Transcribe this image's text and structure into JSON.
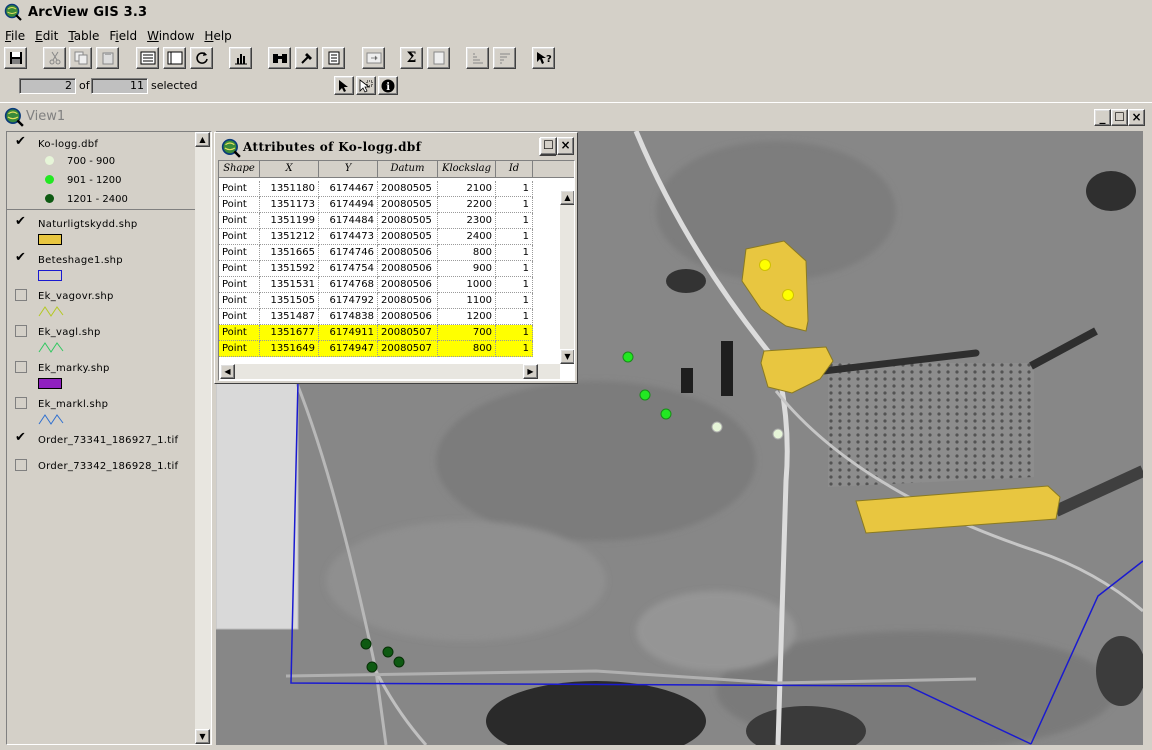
{
  "app": {
    "title": "ArcView GIS 3.3"
  },
  "menu": [
    {
      "label": "File",
      "key": "F"
    },
    {
      "label": "Edit",
      "key": "E"
    },
    {
      "label": "Table",
      "key": "T"
    },
    {
      "label": "Field",
      "key": "i"
    },
    {
      "label": "Window",
      "key": "W"
    },
    {
      "label": "Help",
      "key": "H"
    }
  ],
  "toolbar": {
    "buttons": [
      "save-icon",
      "cut-icon",
      "copy-icon",
      "paste-icon",
      "select-all-icon",
      "select-none-icon",
      "refresh-icon",
      "chart-icon",
      "find-icon",
      "query-icon",
      "statistics-icon",
      "join-icon",
      "summarize-icon",
      "calculate-icon",
      "sort-ascending-icon",
      "sort-descending-icon",
      "help-cursor-icon"
    ]
  },
  "selection": {
    "count": "2",
    "of_label": "of",
    "total": "11",
    "selected_label": "selected"
  },
  "view": {
    "title": "View1"
  },
  "toc": {
    "layers": [
      {
        "name": "Ko-logg.dbf",
        "checked": true,
        "legend": [
          {
            "label": "700 - 900",
            "color": "#e6f5d8"
          },
          {
            "label": "901 - 1200",
            "color": "#22e822"
          },
          {
            "label": "1201 - 2400",
            "color": "#0e5a12"
          }
        ]
      },
      {
        "name": "Naturligtskydd.shp",
        "checked": true,
        "symbol": "fill",
        "color": "#e8c640"
      },
      {
        "name": "Beteshage1.shp",
        "checked": true,
        "symbol": "outline",
        "color": "#1a1ad0"
      },
      {
        "name": "Ek_vagovr.shp",
        "checked": false,
        "symbol": "line",
        "color": "#b4c820"
      },
      {
        "name": "Ek_vagl.shp",
        "checked": false,
        "symbol": "line",
        "color": "#30c860"
      },
      {
        "name": "Ek_marky.shp",
        "checked": false,
        "symbol": "fill",
        "color": "#9020c0"
      },
      {
        "name": "Ek_markl.shp",
        "checked": false,
        "symbol": "line",
        "color": "#3070d0"
      },
      {
        "name": "Order_73341_186927_1.tif",
        "checked": true
      },
      {
        "name": "Order_73342_186928_1.tif",
        "checked": false
      }
    ]
  },
  "attributes": {
    "title": "Attributes of Ko-logg.dbf",
    "columns": [
      "Shape",
      "X",
      "Y",
      "Datum",
      "Klockslag",
      "Id"
    ],
    "rows": [
      {
        "Shape": "Point",
        "X": "1351180",
        "Y": "6174467",
        "Datum": "20080505",
        "Klockslag": "2100",
        "Id": "1",
        "selected": false
      },
      {
        "Shape": "Point",
        "X": "1351173",
        "Y": "6174494",
        "Datum": "20080505",
        "Klockslag": "2200",
        "Id": "1",
        "selected": false
      },
      {
        "Shape": "Point",
        "X": "1351199",
        "Y": "6174484",
        "Datum": "20080505",
        "Klockslag": "2300",
        "Id": "1",
        "selected": false
      },
      {
        "Shape": "Point",
        "X": "1351212",
        "Y": "6174473",
        "Datum": "20080505",
        "Klockslag": "2400",
        "Id": "1",
        "selected": false
      },
      {
        "Shape": "Point",
        "X": "1351665",
        "Y": "6174746",
        "Datum": "20080506",
        "Klockslag": "800",
        "Id": "1",
        "selected": false
      },
      {
        "Shape": "Point",
        "X": "1351592",
        "Y": "6174754",
        "Datum": "20080506",
        "Klockslag": "900",
        "Id": "1",
        "selected": false
      },
      {
        "Shape": "Point",
        "X": "1351531",
        "Y": "6174768",
        "Datum": "20080506",
        "Klockslag": "1000",
        "Id": "1",
        "selected": false
      },
      {
        "Shape": "Point",
        "X": "1351505",
        "Y": "6174792",
        "Datum": "20080506",
        "Klockslag": "1100",
        "Id": "1",
        "selected": false
      },
      {
        "Shape": "Point",
        "X": "1351487",
        "Y": "6174838",
        "Datum": "20080506",
        "Klockslag": "1200",
        "Id": "1",
        "selected": false
      },
      {
        "Shape": "Point",
        "X": "1351677",
        "Y": "6174911",
        "Datum": "20080507",
        "Klockslag": "700",
        "Id": "1",
        "selected": true
      },
      {
        "Shape": "Point",
        "X": "1351649",
        "Y": "6174947",
        "Datum": "20080507",
        "Klockslag": "800",
        "Id": "1",
        "selected": true
      }
    ]
  },
  "colors": {
    "selection_highlight": "#ffff00",
    "polygon_fill": "#e8c640",
    "boundary": "#1a1ad0"
  }
}
